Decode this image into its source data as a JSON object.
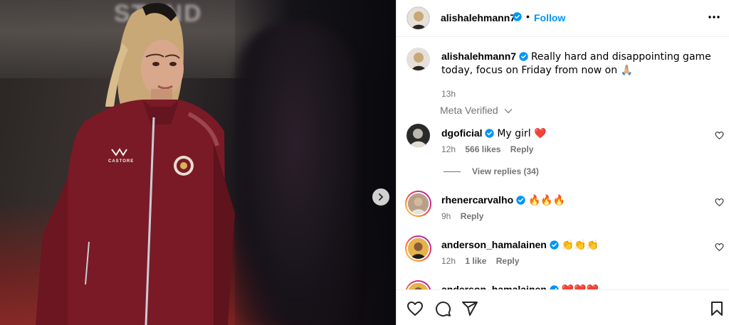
{
  "media": {
    "sign_text": "STAND",
    "jacket_brand": "CASTORE",
    "next_icon": "chevron-right-icon"
  },
  "post": {
    "author": "alishalehmann7",
    "follow_label": "Follow",
    "dot": "•",
    "caption": "Really hard and disappointing game today, focus on Friday from now on 🙏🏼",
    "time": "13h",
    "meta_verified_label": "Meta Verified"
  },
  "comments": [
    {
      "user": "dgoficial",
      "verified": true,
      "text": "My girl ❤️",
      "time": "12h",
      "likes": "566 likes",
      "reply": "Reply",
      "view_replies": "View replies (34)"
    },
    {
      "user": "rhenercarvalho",
      "verified": true,
      "text": "🔥🔥🔥",
      "time": "9h",
      "likes": "",
      "reply": "Reply"
    },
    {
      "user": "anderson_hamalainen",
      "verified": true,
      "text": "👏👏👏",
      "time": "12h",
      "likes": "1 like",
      "reply": "Reply"
    },
    {
      "user": "anderson_hamalainen",
      "verified": true,
      "text": "❤️❤️❤️",
      "time": "",
      "likes": "",
      "reply": ""
    }
  ],
  "icons": {
    "like": "heart-icon",
    "comment": "comment-icon",
    "share": "share-icon",
    "save": "bookmark-icon",
    "more": "more-options-icon"
  },
  "colors": {
    "accent": "#0095f6",
    "verified": "#0095f6",
    "muted": "#737373",
    "jacket": "#7a1a26"
  }
}
